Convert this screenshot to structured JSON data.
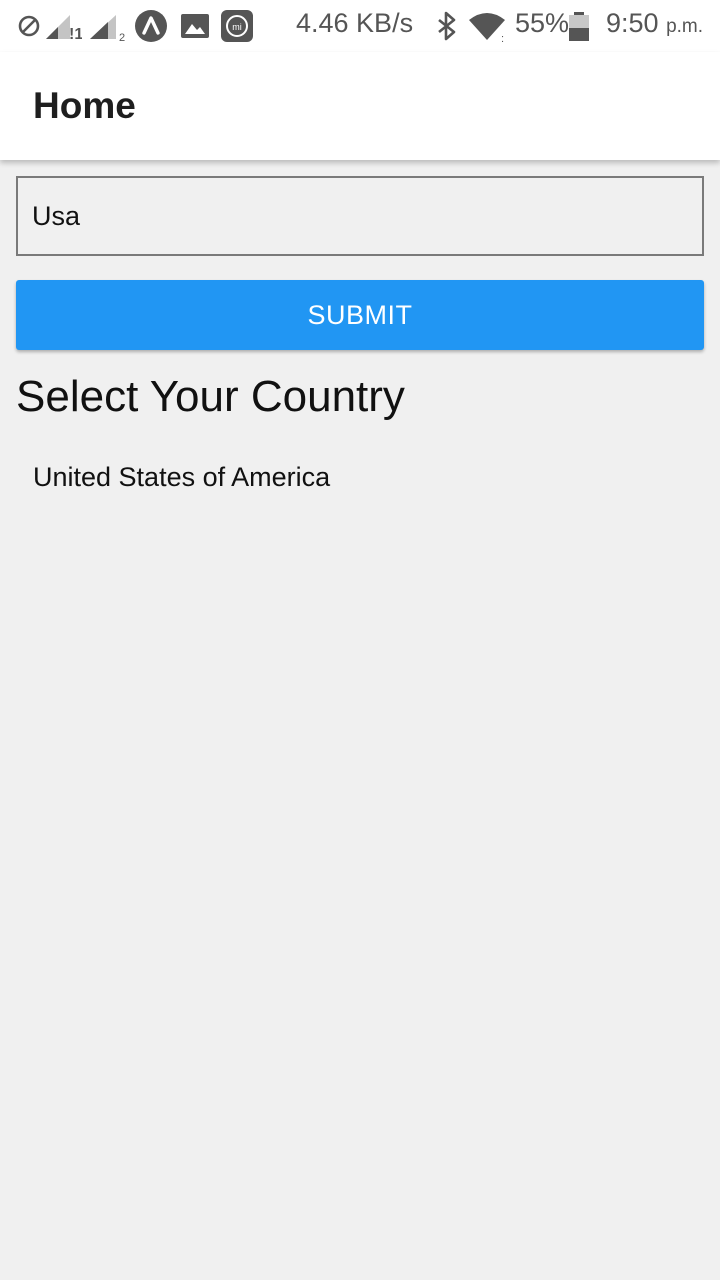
{
  "status_bar": {
    "net_speed": "4.46 KB/s",
    "battery": "55%",
    "time": "9:50",
    "time_suffix": "p.m.",
    "sim1_label": "!1",
    "sim2_label": "2",
    "mi_label": "mi",
    "icons": [
      "do-not-disturb-icon",
      "signal-sim1-icon",
      "signal-sim2-icon",
      "app-a-icon",
      "image-icon",
      "mi-icon",
      "bluetooth-icon",
      "wifi-icon",
      "battery-icon"
    ]
  },
  "app_bar": {
    "title": "Home"
  },
  "search": {
    "value": "Usa",
    "placeholder": ""
  },
  "submit": {
    "label": "SUBMIT"
  },
  "section": {
    "title": "Select Your Country"
  },
  "countries": [
    "United States of America"
  ],
  "colors": {
    "accent": "#2196f3",
    "background": "#f0f0f0",
    "app_bar": "#ffffff",
    "input_border": "#7a7a7a"
  }
}
